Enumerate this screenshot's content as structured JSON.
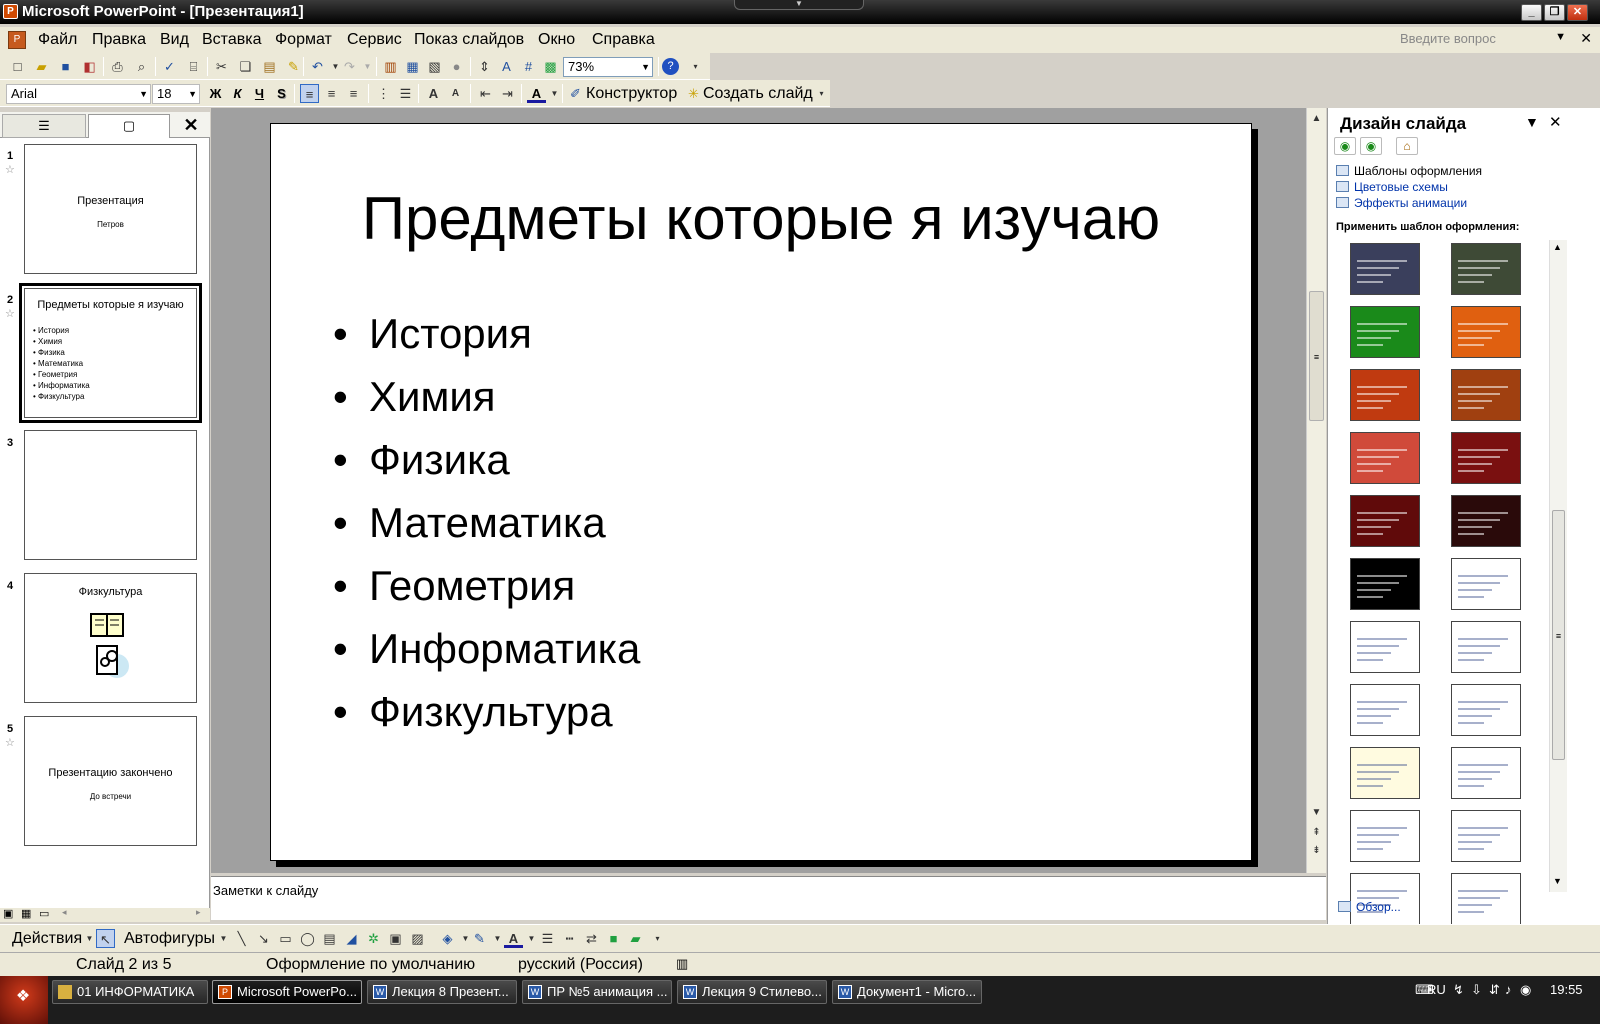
{
  "window": {
    "title": "Microsoft PowerPoint - [Презентация1]",
    "app_icon": "powerpoint-icon"
  },
  "menu": {
    "items": [
      "Файл",
      "Правка",
      "Вид",
      "Вставка",
      "Формат",
      "Сервис",
      "Показ слайдов",
      "Окно",
      "Справка"
    ],
    "help_placeholder": "Введите вопрос"
  },
  "standard_toolbar": {
    "zoom": "73%",
    "icons": [
      "new-icon",
      "open-icon",
      "save-icon",
      "permission-icon",
      "print-icon",
      "print-preview-icon",
      "spelling-icon",
      "research-icon",
      "cut-icon",
      "copy-icon",
      "paste-icon",
      "format-painter-icon",
      "undo-icon",
      "redo-icon",
      "insert-chart-icon",
      "insert-table-icon",
      "tables-borders-icon",
      "hyperlink-icon",
      "expand-icon",
      "show-formatting-icon",
      "grid-icon",
      "color-grayscale-icon",
      "help-icon"
    ]
  },
  "formatting_toolbar": {
    "font": "Arial",
    "size": "18",
    "bold": "Ж",
    "italic": "К",
    "underline": "Ч",
    "shadow": "S",
    "design_button": "Конструктор",
    "new_slide_button": "Создать слайд"
  },
  "slides": [
    {
      "num": "1",
      "title": "Презентация",
      "subtitle": "Петров"
    },
    {
      "num": "2",
      "title": "Предметы которые я изучаю",
      "bullets": [
        "История",
        "Химия",
        "Физика",
        "Математика",
        "Геометрия",
        "Информатика",
        "Физкультура"
      ]
    },
    {
      "num": "3",
      "title": ""
    },
    {
      "num": "4",
      "title": "Физкультура"
    },
    {
      "num": "5",
      "title": "Презентацию закончено",
      "subtitle": "До встречи"
    }
  ],
  "current_slide": {
    "title": "Предметы которые я изучаю",
    "bullets": [
      "История",
      "Химия",
      "Физика",
      "Математика",
      "Геометрия",
      "Информатика",
      "Физкультура"
    ]
  },
  "notes": {
    "placeholder": "Заметки к слайду"
  },
  "task_pane": {
    "title": "Дизайн слайда",
    "links": [
      "Шаблоны оформления",
      "Цветовые схемы",
      "Эффекты анимации"
    ],
    "apply_label": "Применить шаблон оформления:",
    "browse": "Обзор...",
    "template_colors": [
      [
        "#3a3f5c",
        "#3e4a36"
      ],
      [
        "#1a8a1a",
        "#e06010"
      ],
      [
        "#c03a10",
        "#a04010"
      ],
      [
        "#d04a3a",
        "#7a1010"
      ],
      [
        "#600a0a",
        "#2a0a0a"
      ],
      [
        "#000000",
        "#ffffff"
      ],
      [
        "#ffffff",
        "#ffffff"
      ],
      [
        "#ffffff",
        "#ffffff"
      ],
      [
        "#fffbe0",
        "#ffffff"
      ],
      [
        "#ffffff",
        "#ffffff"
      ],
      [
        "#ffffff",
        "#ffffff"
      ]
    ]
  },
  "drawing_toolbar": {
    "actions": "Действия",
    "autoshapes": "Автофигуры"
  },
  "status": {
    "slide": "Слайд 2 из 5",
    "design": "Оформление по умолчанию",
    "language": "русский (Россия)"
  },
  "taskbar": {
    "tasks": [
      "01 ИНФОРМАТИКА",
      "Microsoft PowerPo...",
      "Лекция 8 Презент...",
      "ПР №5 анимация ...",
      "Лекция 9 Стилево...",
      "Документ1 - Micro..."
    ],
    "lang": "RU",
    "time": "19:55"
  }
}
